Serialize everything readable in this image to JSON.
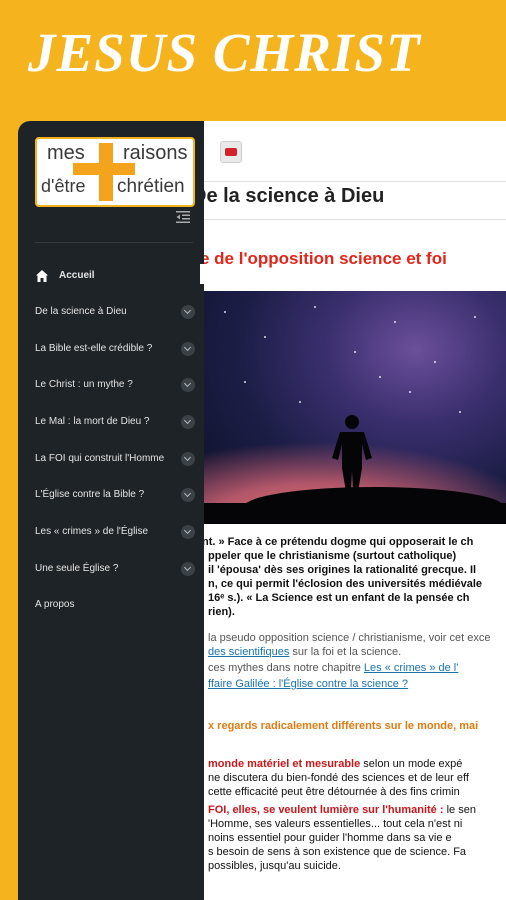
{
  "banner": {
    "title": "JESUS CHRIST"
  },
  "sidebar": {
    "logo": {
      "line1a": "mes",
      "line1b": "raisons",
      "line2a": "d'être",
      "line2b": "chrétien"
    },
    "items": [
      {
        "label": "Accueil"
      },
      {
        "label": "De la science à Dieu"
      },
      {
        "label": "La Bible est-elle crédible ?"
      },
      {
        "label": "Le Christ : un mythe ?"
      },
      {
        "label": "Le Mal : la mort de Dieu ?"
      },
      {
        "label": "La FOI qui construit l'Homme"
      },
      {
        "label": "L'Église contre la Bible ?"
      },
      {
        "label": "Les « crimes » de l'Église"
      },
      {
        "label": "Une seule Église ?"
      },
      {
        "label": "A propos"
      }
    ]
  },
  "main": {
    "page_title": "De la science à Dieu",
    "section_title": "e de l'opposition science et foi",
    "lines": [
      "nt. » Face à ce prétendu dogme qui opposerait le ch",
      "ppeler que le christianisme (surtout catholique)",
      "il 'épousa' dès ses origines la rationalité grecque. Il",
      "n, ce qui permit l'éclosion des universités médiévale",
      "16ᵉ s.). « La Science est un enfant de la pensée ch",
      "rien).",
      "la pseudo opposition science / christianisme, voir cet exce",
      "des scientifiques",
      "sur la foi et la science.",
      "ces mythes dans notre chapitre",
      "Les « crimes » de l'",
      "ffaire Galilée : l'Église contre la science ?",
      "x regards radicalement différents sur le monde, mai",
      "monde matériel et mesurable",
      "selon un mode expé",
      "ne discutera du bien-fondé des sciences et de leur eff",
      "cette efficacité peut être détournée à des fins crimin",
      "FOI, elles, se veulent lumière sur l'humanité :",
      "le sen",
      "'Homme, ses valeurs essentielles... tout cela n'est ni",
      "noins essentiel pour guider l'homme dans sa vie e",
      "s besoin de sens à son existence que de science. Fa",
      "possibles, jusqu'au suicide."
    ]
  }
}
